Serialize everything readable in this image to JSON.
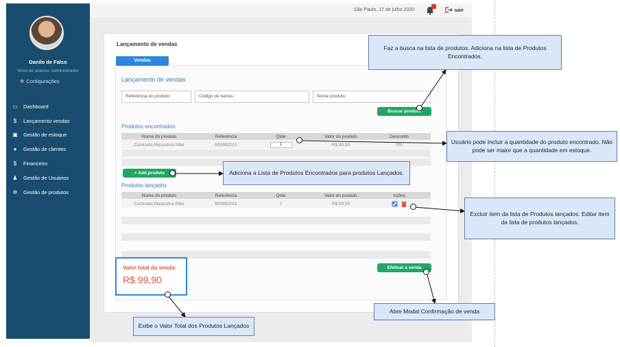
{
  "sidebar": {
    "user_name": "Danilo de Falco",
    "user_level": "Nível de acesso: Administrador",
    "config_label": "Configurações",
    "items": [
      {
        "label": "Dashboard",
        "icon": "dashboard-icon"
      },
      {
        "label": "Lançamento vendas",
        "icon": "dollar-icon"
      },
      {
        "label": "Gestão de estoque",
        "icon": "boxes-icon"
      },
      {
        "label": "Gestão de clientes",
        "icon": "users-icon"
      },
      {
        "label": "Financeiro",
        "icon": "dollar-icon"
      },
      {
        "label": "Gestão de Usuários",
        "icon": "people-icon"
      },
      {
        "label": "Gestão de produtos",
        "icon": "gear-icon"
      }
    ]
  },
  "topbar": {
    "date": "São Paulo, 17 de julho 2020",
    "logout": "sair"
  },
  "card": {
    "title": "Lançamento de vendas",
    "tab": "Vendas",
    "form_title": "Lançamento de vendas",
    "fields": {
      "referencia": "Referência do produto",
      "codigo": "Código de barras",
      "nome": "Nome produto"
    },
    "search_button": "Buscar produto",
    "found": {
      "title": "Produtos encontrados",
      "headers": [
        "Nome do produto",
        "Referência",
        "Qtde",
        "Valor do produto",
        "Desconto"
      ],
      "row": {
        "nome": "Camiseta Masculina Nike",
        "referencia": "893992021",
        "qtde": "1",
        "valor": "R$ 99,90",
        "desconto": "0%"
      }
    },
    "add_button": "+ Add produto",
    "launched": {
      "title": "Produtos lançados",
      "headers": [
        "Nome do produto",
        "Referência",
        "Qtde",
        "Valor do produto",
        "Ações"
      ],
      "row": {
        "nome": "Camiseta Masculina Nike",
        "referencia": "893992021",
        "qtde": "1",
        "valor": "R$ 99,90"
      }
    },
    "total_label": "Valor total da venda:",
    "total_value": "R$ 99,90",
    "confirm_button": "Efetivar a venda"
  },
  "annotations": {
    "search": "Faz a busca na lista de produtos. Adiciona na lista de Produtos Encontrados.",
    "quantity": "Usuário pode Incluir a quantidade do produto encontrado. Não pode ser maior que a quantidade em estoque.",
    "add": "Adiciona a Lista de Produtos Encontrados para produtos Lançados.",
    "actions": "Excluir item da lista de Produtos lançados. Editar item da lista de produtos lançados.",
    "confirm": "Abre Modal Confirmação de venda",
    "total": "Exibe o Valor Total dos Produtos Lançados"
  },
  "colors": {
    "sidebar": "#184d6f",
    "accent_blue": "#2e86de",
    "green": "#1ea864",
    "total_red": "#e5533d",
    "note_bg": "#dae7f7"
  }
}
